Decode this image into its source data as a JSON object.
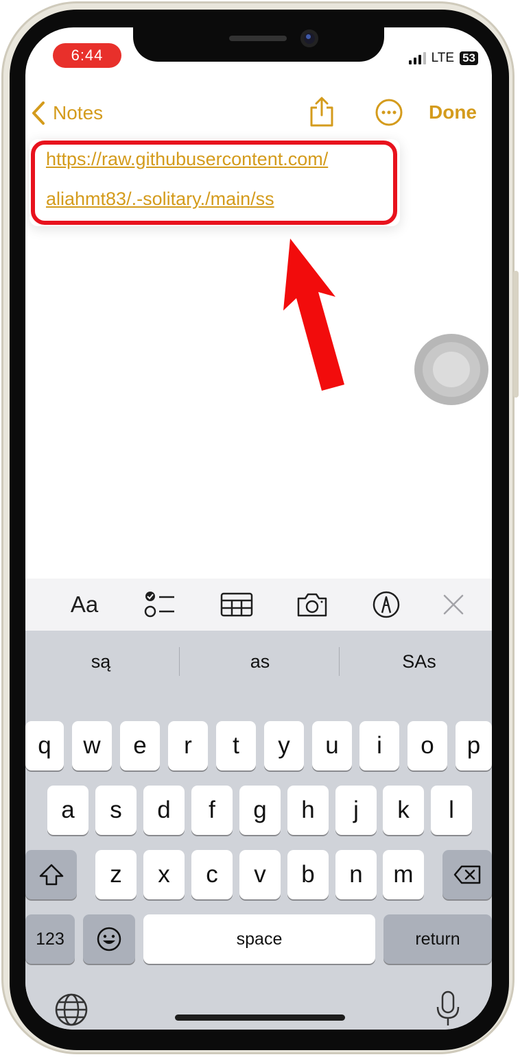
{
  "status_bar": {
    "time": "6:44",
    "network": "LTE",
    "battery": "53"
  },
  "nav": {
    "back_label": "Notes",
    "done_label": "Done"
  },
  "note": {
    "link_line_1": "https://raw.githubusercontent.com/",
    "link_line_2": "aliahmt83/.-solitary./main/ss"
  },
  "toolbar": {
    "format_label": "Aa"
  },
  "suggestions": [
    "są",
    "as",
    "SAs"
  ],
  "keyboard": {
    "row1": [
      "q",
      "w",
      "e",
      "r",
      "t",
      "y",
      "u",
      "i",
      "o",
      "p"
    ],
    "row2": [
      "a",
      "s",
      "d",
      "f",
      "g",
      "h",
      "j",
      "k",
      "l"
    ],
    "row3": [
      "z",
      "x",
      "c",
      "v",
      "b",
      "n",
      "m"
    ],
    "numbers_label": "123",
    "space_label": "space",
    "return_label": "return"
  },
  "colors": {
    "accent": "#d49b1c",
    "highlight": "#e8121d",
    "time_pill": "#e8302b"
  },
  "icons": {
    "back": "chevron-left-icon",
    "share": "share-icon",
    "more": "ellipsis-circle-icon",
    "checklist": "checklist-icon",
    "table": "table-icon",
    "camera": "camera-icon",
    "markup": "pen-markup-icon",
    "close": "close-icon",
    "shift": "shift-icon",
    "delete": "delete-icon",
    "emoji": "emoji-icon",
    "globe": "globe-icon",
    "mic": "microphone-icon"
  }
}
